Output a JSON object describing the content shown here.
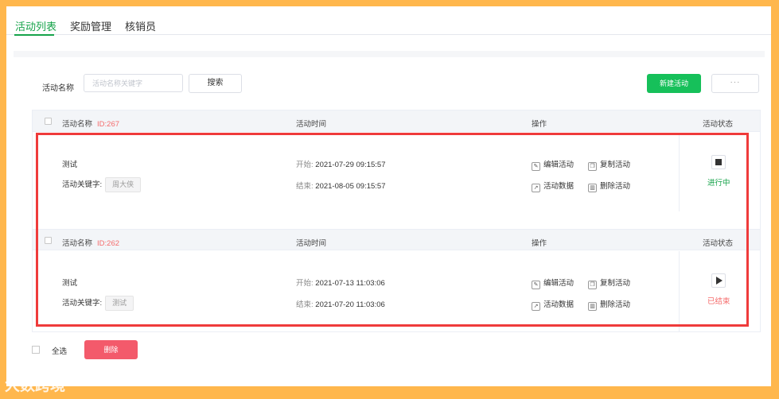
{
  "tabs": [
    {
      "label": "活动列表"
    },
    {
      "label": "奖励管理"
    },
    {
      "label": "核销员"
    }
  ],
  "toolbar": {
    "search_label": "活动名称",
    "search_placeholder": "活动名称关键字",
    "search_button": "搜索",
    "new_button": "新建活动",
    "more_button": "···"
  },
  "columns": {
    "name": "活动名称",
    "time": "活动时间",
    "ops": "操作",
    "status": "活动状态"
  },
  "activities": [
    {
      "id_text": "ID:267",
      "name": "测试",
      "keyword_label": "活动关键字:",
      "keyword": "周大侠",
      "start_label": "开始:",
      "start": "2021-07-29 09:15:57",
      "end_label": "结束:",
      "end": "2021-08-05 09:15:57",
      "ops": {
        "edit": "编辑活动",
        "copy": "复制活动",
        "data": "活动数据",
        "delete": "删除活动"
      },
      "status": "进行中",
      "status_color": "#16a34a"
    },
    {
      "id_text": "ID:262",
      "name": "测试",
      "keyword_label": "活动关键字:",
      "keyword": "测试",
      "start_label": "开始:",
      "start": "2021-07-13 11:03:06",
      "end_label": "结束:",
      "end": "2021-07-20 11:03:06",
      "ops": {
        "edit": "编辑活动",
        "copy": "复制活动",
        "data": "活动数据",
        "delete": "删除活动"
      },
      "status": "已结束",
      "status_color": "#f56c6c"
    }
  ],
  "footer": {
    "select_all": "全选",
    "delete_button": "删除"
  },
  "watermark": "大数跨境",
  "colors": {
    "accent": "#16c05a",
    "danger": "#f35a6b",
    "highlight_box": "#ef3b3b"
  }
}
